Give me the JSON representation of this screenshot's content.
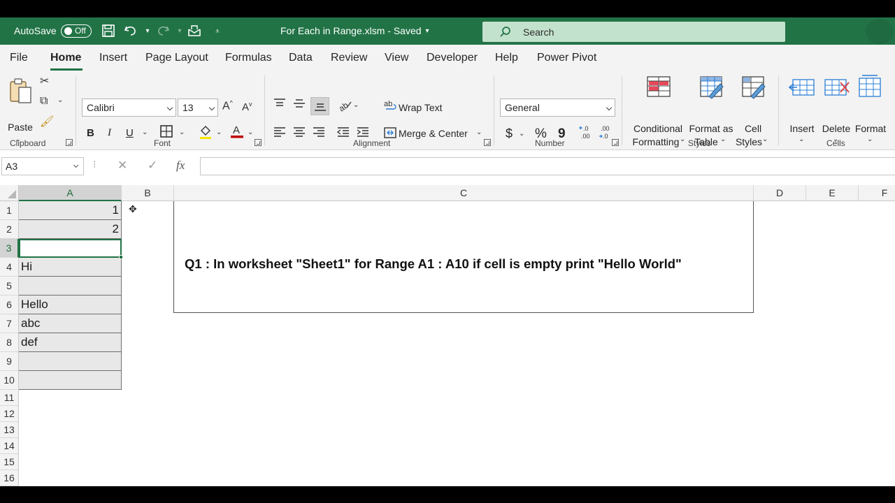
{
  "titlebar": {
    "autosave_label": "AutoSave",
    "autosave_state": "Off",
    "document_title": "For Each in Range.xlsm  -  Saved",
    "search_placeholder": "Search",
    "accent_color": "#217346"
  },
  "tabs": [
    "File",
    "Home",
    "Insert",
    "Page Layout",
    "Formulas",
    "Data",
    "Review",
    "View",
    "Developer",
    "Help",
    "Power Pivot"
  ],
  "active_tab": "Home",
  "ribbon": {
    "clipboard": {
      "paste_label": "Paste",
      "group_label": "Clipboard"
    },
    "font": {
      "font_name": "Calibri",
      "font_size": "13",
      "bold": "B",
      "italic": "I",
      "underline": "U",
      "group_label": "Font"
    },
    "alignment": {
      "wrap_text": "Wrap Text",
      "merge_center": "Merge & Center",
      "group_label": "Alignment"
    },
    "number": {
      "format": "General",
      "currency": "$",
      "percent": "%",
      "comma": "9",
      "group_label": "Number"
    },
    "styles": {
      "conditional_1": "Conditional",
      "conditional_2": "Formatting",
      "format_table_1": "Format as",
      "format_table_2": "Table",
      "cell_styles_1": "Cell",
      "cell_styles_2": "Styles",
      "group_label": "Styles"
    },
    "cells": {
      "insert": "Insert",
      "delete": "Delete",
      "format": "Format",
      "group_label": "Cells"
    }
  },
  "formula_bar": {
    "name_box": "A3",
    "fx": "fx",
    "value": ""
  },
  "columns": [
    "A",
    "B",
    "C",
    "D",
    "E",
    "F"
  ],
  "rows": [
    "1",
    "2",
    "3",
    "4",
    "5",
    "6",
    "7",
    "8",
    "9",
    "10",
    "11",
    "12",
    "13",
    "14",
    "15",
    "16"
  ],
  "cells_A": [
    "1",
    "2",
    "",
    "Hi",
    "",
    "Hello",
    "abc",
    "def",
    "",
    ""
  ],
  "selected_cell": "A3",
  "textbox": {
    "question": "Q1 : In worksheet \"Sheet1\" for Range A1 : A10 if cell is empty print \"Hello World\""
  }
}
